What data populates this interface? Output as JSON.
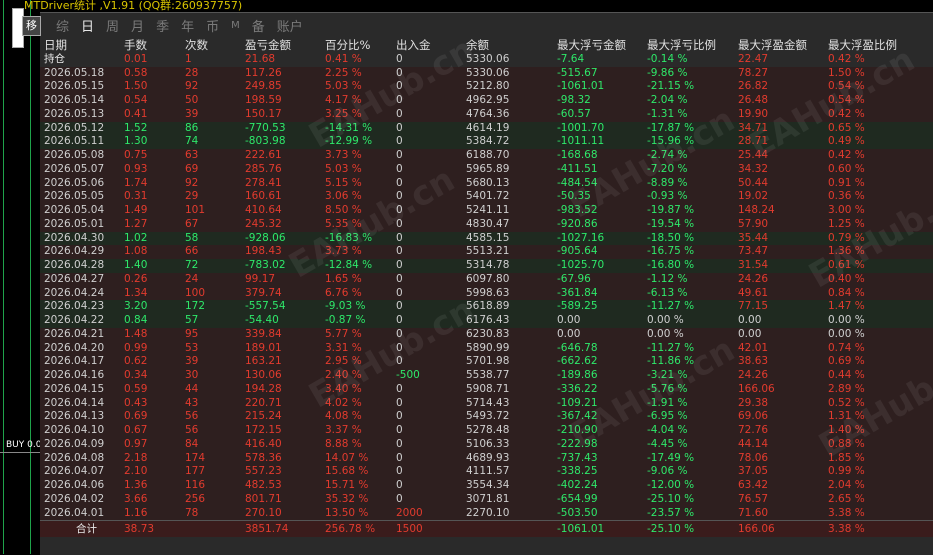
{
  "title": "MTDriver统计 ,V1.91 (QQ群:260937757)",
  "side_tab_label": "移",
  "buy_label": "BUY 0.0",
  "tabs": [
    "综",
    "日",
    "周",
    "月",
    "季",
    "年",
    "币",
    "M",
    "备",
    "账户"
  ],
  "active_tab": "日",
  "watermark": "EAHub.cn",
  "headers": [
    "日期",
    "手数",
    "次数",
    "盈亏金额",
    "百分比%",
    "出入金",
    "余额",
    "最大浮亏金额",
    "最大浮亏比例",
    "最大浮盈金额",
    "最大浮盈比例"
  ],
  "holding": [
    "持仓",
    "0.01",
    "1",
    "21.68",
    "0.41 %",
    "0",
    "5330.06",
    "-7.64",
    "-0.14 %",
    "22.47",
    "0.42 %"
  ],
  "rows": [
    [
      "2026.05.18",
      "0.58",
      "28",
      "117.26",
      "2.25 %",
      "0",
      "5330.06",
      "-515.67",
      "-9.86 %",
      "78.27",
      "1.50 %"
    ],
    [
      "2026.05.15",
      "1.50",
      "92",
      "249.85",
      "5.03 %",
      "0",
      "5212.80",
      "-1061.01",
      "-21.15 %",
      "26.82",
      "0.54 %"
    ],
    [
      "2026.05.14",
      "0.54",
      "50",
      "198.59",
      "4.17 %",
      "0",
      "4962.95",
      "-98.32",
      "-2.04 %",
      "26.48",
      "0.54 %"
    ],
    [
      "2026.05.13",
      "0.41",
      "39",
      "150.17",
      "3.25 %",
      "0",
      "4764.36",
      "-60.57",
      "-1.31 %",
      "19.90",
      "0.42 %"
    ],
    [
      "2026.05.12",
      "1.52",
      "86",
      "-770.53",
      "-14.31 %",
      "0",
      "4614.19",
      "-1001.70",
      "-17.87 %",
      "34.71",
      "0.65 %"
    ],
    [
      "2026.05.11",
      "1.30",
      "74",
      "-803.98",
      "-12.99 %",
      "0",
      "5384.72",
      "-1011.11",
      "-15.96 %",
      "28.71",
      "0.49 %"
    ],
    [
      "2026.05.08",
      "0.75",
      "63",
      "222.61",
      "3.73 %",
      "0",
      "6188.70",
      "-168.68",
      "-2.74 %",
      "25.44",
      "0.42 %"
    ],
    [
      "2026.05.07",
      "0.93",
      "69",
      "285.76",
      "5.03 %",
      "0",
      "5965.89",
      "-411.51",
      "-7.20 %",
      "34.32",
      "0.60 %"
    ],
    [
      "2026.05.06",
      "1.74",
      "92",
      "278.41",
      "5.15 %",
      "0",
      "5680.13",
      "-484.54",
      "-8.89 %",
      "50.44",
      "0.91 %"
    ],
    [
      "2026.05.05",
      "0.31",
      "29",
      "160.61",
      "3.06 %",
      "0",
      "5401.72",
      "-50.35",
      "-0.93 %",
      "19.02",
      "0.36 %"
    ],
    [
      "2026.05.04",
      "1.49",
      "101",
      "410.64",
      "8.50 %",
      "0",
      "5241.11",
      "-983.52",
      "-19.87 %",
      "148.24",
      "3.00 %"
    ],
    [
      "2026.05.01",
      "1.27",
      "67",
      "245.32",
      "5.35 %",
      "0",
      "4830.47",
      "-920.86",
      "-19.54 %",
      "57.90",
      "1.25 %"
    ],
    [
      "2026.04.30",
      "1.02",
      "58",
      "-928.06",
      "-16.83 %",
      "0",
      "4585.15",
      "-1027.16",
      "-18.50 %",
      "35.44",
      "0.79 %"
    ],
    [
      "2026.04.29",
      "1.08",
      "66",
      "198.43",
      "3.73 %",
      "0",
      "5513.21",
      "-905.64",
      "-16.75 %",
      "73.47",
      "1.36 %"
    ],
    [
      "2026.04.28",
      "1.40",
      "72",
      "-783.02",
      "-12.84 %",
      "0",
      "5314.78",
      "-1025.70",
      "-16.80 %",
      "31.54",
      "0.61 %"
    ],
    [
      "2026.04.27",
      "0.26",
      "24",
      "99.17",
      "1.65 %",
      "0",
      "6097.80",
      "-67.96",
      "-1.12 %",
      "24.26",
      "0.40 %"
    ],
    [
      "2026.04.24",
      "1.34",
      "100",
      "379.74",
      "6.76 %",
      "0",
      "5998.63",
      "-361.84",
      "-6.13 %",
      "49.61",
      "0.84 %"
    ],
    [
      "2026.04.23",
      "3.20",
      "172",
      "-557.54",
      "-9.03 %",
      "0",
      "5618.89",
      "-589.25",
      "-11.27 %",
      "77.15",
      "1.47 %"
    ],
    [
      "2026.04.22",
      "0.84",
      "57",
      "-54.40",
      "-0.87 %",
      "0",
      "6176.43",
      "0.00",
      "0.00 %",
      "0.00",
      "0.00 %"
    ],
    [
      "2026.04.21",
      "1.48",
      "95",
      "339.84",
      "5.77 %",
      "0",
      "6230.83",
      "0.00",
      "0.00 %",
      "0.00",
      "0.00 %"
    ],
    [
      "2026.04.20",
      "0.99",
      "53",
      "189.01",
      "3.31 %",
      "0",
      "5890.99",
      "-646.78",
      "-11.27 %",
      "42.01",
      "0.74 %"
    ],
    [
      "2026.04.17",
      "0.62",
      "39",
      "163.21",
      "2.95 %",
      "0",
      "5701.98",
      "-662.62",
      "-11.86 %",
      "38.63",
      "0.69 %"
    ],
    [
      "2026.04.16",
      "0.34",
      "30",
      "130.06",
      "2.40 %",
      "-500",
      "5538.77",
      "-189.86",
      "-3.21 %",
      "24.26",
      "0.44 %"
    ],
    [
      "2026.04.15",
      "0.59",
      "44",
      "194.28",
      "3.40 %",
      "0",
      "5908.71",
      "-336.22",
      "-5.76 %",
      "166.06",
      "2.89 %"
    ],
    [
      "2026.04.14",
      "0.43",
      "43",
      "220.71",
      "4.02 %",
      "0",
      "5714.43",
      "-109.21",
      "-1.91 %",
      "29.38",
      "0.52 %"
    ],
    [
      "2026.04.13",
      "0.69",
      "56",
      "215.24",
      "4.08 %",
      "0",
      "5493.72",
      "-367.42",
      "-6.95 %",
      "69.06",
      "1.31 %"
    ],
    [
      "2026.04.10",
      "0.67",
      "56",
      "172.15",
      "3.37 %",
      "0",
      "5278.48",
      "-210.90",
      "-4.04 %",
      "72.76",
      "1.40 %"
    ],
    [
      "2026.04.09",
      "0.97",
      "84",
      "416.40",
      "8.88 %",
      "0",
      "5106.33",
      "-222.98",
      "-4.45 %",
      "44.14",
      "0.88 %"
    ],
    [
      "2026.04.08",
      "2.18",
      "174",
      "578.36",
      "14.07 %",
      "0",
      "4689.93",
      "-737.43",
      "-17.49 %",
      "78.06",
      "1.85 %"
    ],
    [
      "2026.04.07",
      "2.10",
      "177",
      "557.23",
      "15.68 %",
      "0",
      "4111.57",
      "-338.25",
      "-9.06 %",
      "37.05",
      "0.99 %"
    ],
    [
      "2026.04.06",
      "1.36",
      "116",
      "482.53",
      "15.71 %",
      "0",
      "3554.34",
      "-402.24",
      "-12.00 %",
      "63.42",
      "2.04 %"
    ],
    [
      "2026.04.02",
      "3.66",
      "256",
      "801.71",
      "35.32 %",
      "0",
      "3071.81",
      "-654.99",
      "-25.10 %",
      "76.57",
      "2.65 %"
    ],
    [
      "2026.04.01",
      "1.16",
      "78",
      "270.10",
      "13.50 %",
      "2000",
      "2270.10",
      "-503.50",
      "-23.57 %",
      "71.60",
      "3.38 %"
    ]
  ],
  "total": [
    "合计",
    "38.73",
    "",
    "3851.74",
    "256.78 %",
    "1500",
    "",
    "-1061.01",
    "-25.10 %",
    "166.06",
    "3.38 %"
  ],
  "colors": {
    "profit": "#e23b2e",
    "loss": "#2ee86a",
    "panel_bg": "#2a2a2a"
  }
}
